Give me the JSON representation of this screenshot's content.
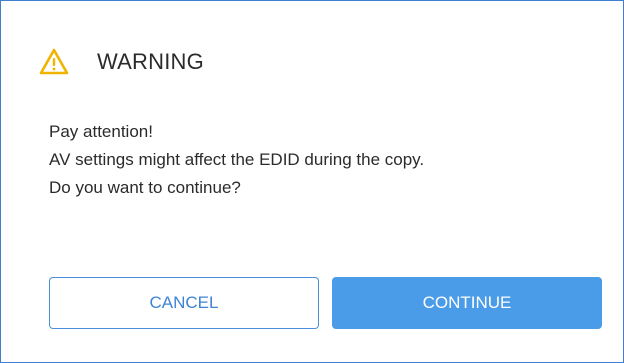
{
  "dialog": {
    "title": "WARNING",
    "icon": "warning-icon",
    "message_lines": [
      "Pay attention!",
      "AV settings might affect the EDID during the copy.",
      "Do you want to continue?"
    ],
    "buttons": {
      "cancel_label": "CANCEL",
      "continue_label": "CONTINUE"
    }
  },
  "colors": {
    "border": "#3f7fcf",
    "warning_icon": "#f0b400",
    "cancel_text": "#3f84d3",
    "continue_bg": "#4a9be8",
    "continue_text": "#ffffff"
  }
}
